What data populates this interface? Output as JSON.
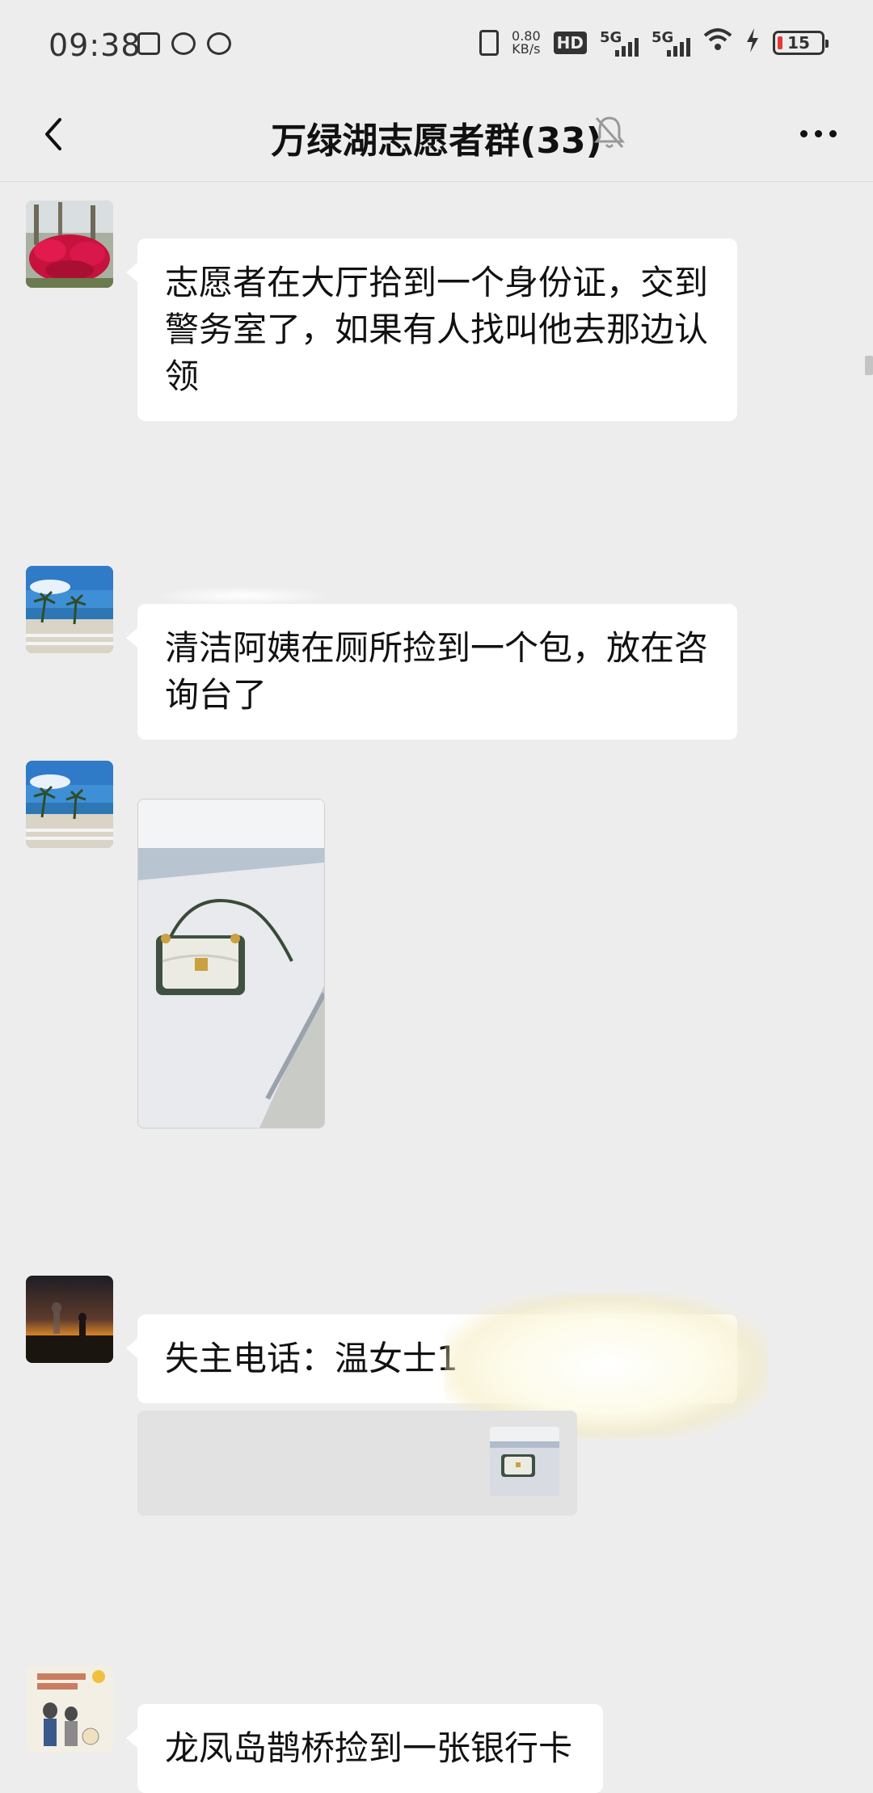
{
  "status_bar": {
    "time": "09:38",
    "net_speed_value": "0.80",
    "net_speed_unit": "KB/s",
    "hd_label": "HD",
    "sim1_label": "5G",
    "sim2_label": "5G",
    "battery": "15"
  },
  "header": {
    "title": "万绿湖志愿者群(33)"
  },
  "messages": [
    {
      "type": "text",
      "text": "志愿者在大厅拾到一个身份证，交到警务室了，如果有人找叫他去那边认领"
    },
    {
      "type": "text",
      "text": "清洁阿姨在厕所捡到一个包，放在咨询台了"
    },
    {
      "type": "image",
      "alt": ""
    },
    {
      "type": "text",
      "text": "失主电话：温女士1"
    },
    {
      "type": "text",
      "text": "龙凤岛鹊桥捡到一张银行卡"
    }
  ],
  "colors": {
    "background": "#ededed",
    "bubble": "#ffffff",
    "quote": "#e2e2e2",
    "battery_low": "#e53935"
  }
}
